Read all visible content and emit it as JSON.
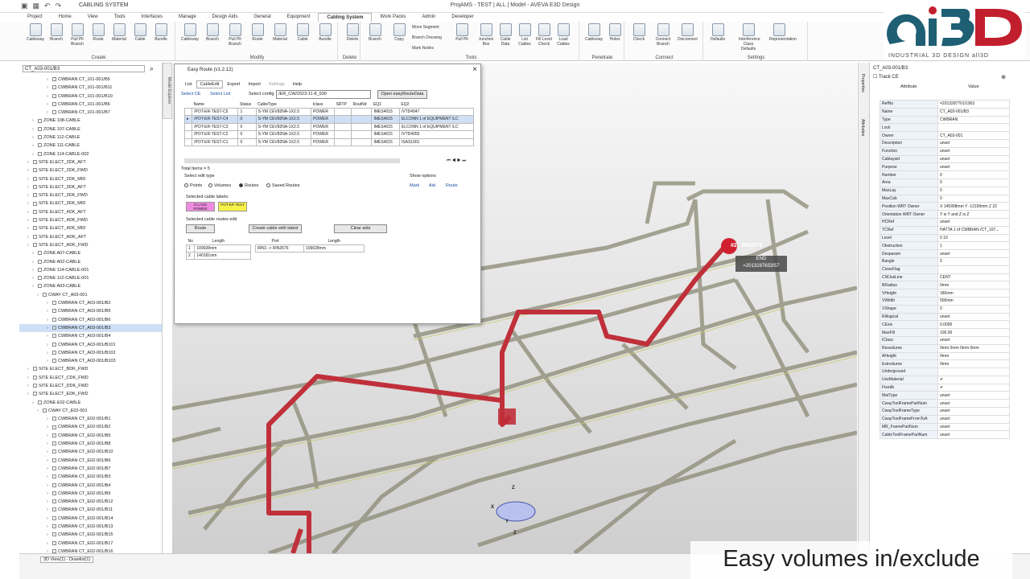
{
  "window": {
    "context_title": "CABLING SYSTEM",
    "title": "ProjAMS - TEST | ALL | Model - AVEVA E3D Design"
  },
  "menu_tabs": [
    "Project",
    "Home",
    "View",
    "Tools",
    "Interfaces",
    "Manage",
    "Design Aids",
    "General",
    "Equipment",
    "Cabling System",
    "Work Packs",
    "Admin",
    "Developer"
  ],
  "active_tab": "Cabling System",
  "ribbon": {
    "groups": [
      "Create",
      "Modify",
      "Delete",
      "Tools",
      "Penetrate",
      "Connect",
      "Settings"
    ],
    "create": [
      "Cableway",
      "Branch",
      "Pull Pit Branch",
      "Route",
      "Material",
      "Cable",
      "Bundle"
    ],
    "modify": [
      "Cableway",
      "Branch",
      "Pull Pit Branch",
      "Route",
      "Material",
      "Cable",
      "Bundle"
    ],
    "delete": [
      "Delete"
    ],
    "tools": [
      "Branch",
      "Copy",
      "Pull Pit",
      "Junction Box",
      "Cable Data",
      "List Cables",
      "Fill Level Check",
      "Load Cables"
    ],
    "tools_small": [
      "Move Segment",
      "Branch Dressing",
      "Mark Nodes"
    ],
    "penetrate": [
      "Cableway",
      "Holes"
    ],
    "connect": [
      "Check",
      "Connect Branch",
      "Disconnect"
    ],
    "settings": [
      "Defaults",
      "Interference Class Defaults",
      "Representation"
    ]
  },
  "brand": {
    "logo_text": "ai3D",
    "tagline": "INDUSTRIAL 3D DESIGN all3D",
    "colors": {
      "a": "#1e5f74",
      "i": "#c21f2e",
      "d": "#c21f2e"
    }
  },
  "explorer": {
    "combo_value": "CT_A03-001/B3",
    "side_tab": "Model Explorer",
    "tree": [
      {
        "d": 5,
        "t": "CWBRAN CT_101-001/B5"
      },
      {
        "d": 5,
        "t": "CWBRAN CT_101-001/B11"
      },
      {
        "d": 5,
        "t": "CWBRAN CT_101-001/B10"
      },
      {
        "d": 5,
        "t": "CWBRAN CT_101-001/B6"
      },
      {
        "d": 5,
        "t": "CWBRAN CT_101-001/B7"
      },
      {
        "d": 2,
        "t": "ZONE 108-CABLE"
      },
      {
        "d": 2,
        "t": "ZONE 107-CABLE"
      },
      {
        "d": 2,
        "t": "ZONE 112-CABLE"
      },
      {
        "d": 2,
        "t": "ZONE 111-CABLE"
      },
      {
        "d": 2,
        "t": "ZONE 114-CABLE-002"
      },
      {
        "d": 1,
        "t": "SITE ELECT_2DK_AFT"
      },
      {
        "d": 1,
        "t": "SITE ELECT_2DK_FWD"
      },
      {
        "d": 1,
        "t": "SITE ELECT_2DK_MID"
      },
      {
        "d": 1,
        "t": "SITE ELECT_3DK_AFT"
      },
      {
        "d": 1,
        "t": "SITE ELECT_3DK_FWD"
      },
      {
        "d": 1,
        "t": "SITE ELECT_3DK_MID"
      },
      {
        "d": 1,
        "t": "SITE ELECT_4DK_AFT"
      },
      {
        "d": 1,
        "t": "SITE ELECT_4DK_FWD"
      },
      {
        "d": 1,
        "t": "SITE ELECT_4DK_MID"
      },
      {
        "d": 1,
        "t": "SITE ELECT_ADK_AFT"
      },
      {
        "d": 1,
        "t": "SITE ELECT_ADK_FWD"
      },
      {
        "d": 2,
        "t": "ZONE A07-CABLE"
      },
      {
        "d": 2,
        "t": "ZONE A02-CABLE"
      },
      {
        "d": 2,
        "t": "ZONE 114-CABLE-001"
      },
      {
        "d": 2,
        "t": "ZONE 112-CABLE-001"
      },
      {
        "d": 2,
        "t": "ZONE A03-CABLE"
      },
      {
        "d": 3,
        "t": "CWAY CT_A03-001"
      },
      {
        "d": 5,
        "t": "CWBRAN CT_A03-001/B2"
      },
      {
        "d": 5,
        "t": "CWBRAN CT_A03-001/B5"
      },
      {
        "d": 5,
        "t": "CWBRAN CT_A03-001/B6"
      },
      {
        "d": 5,
        "t": "CWBRAN CT_A03-001/B3",
        "sel": true
      },
      {
        "d": 5,
        "t": "CWBRAN CT_A03-001/B4"
      },
      {
        "d": 5,
        "t": "CWBRAN CT_A03-001/B101"
      },
      {
        "d": 5,
        "t": "CWBRAN CT_A03-001/B102"
      },
      {
        "d": 5,
        "t": "CWBRAN CT_A03-001/B103"
      },
      {
        "d": 1,
        "t": "SITE ELECT_BDK_FWD"
      },
      {
        "d": 1,
        "t": "SITE ELECT_CDK_FWD"
      },
      {
        "d": 1,
        "t": "SITE ELECT_DDK_FWD"
      },
      {
        "d": 1,
        "t": "SITE ELECT_EDK_FWD"
      },
      {
        "d": 2,
        "t": "ZONE E02-CABLE"
      },
      {
        "d": 3,
        "t": "CWAY CT_E02-001"
      },
      {
        "d": 5,
        "t": "CWBRAN CT_E02-001/B1"
      },
      {
        "d": 5,
        "t": "CWBRAN CT_E02-001/B2"
      },
      {
        "d": 5,
        "t": "CWBRAN CT_E02-001/B5"
      },
      {
        "d": 5,
        "t": "CWBRAN CT_E02-001/B8"
      },
      {
        "d": 5,
        "t": "CWBRAN CT_E02-001/B10"
      },
      {
        "d": 5,
        "t": "CWBRAN CT_E02-001/B6"
      },
      {
        "d": 5,
        "t": "CWBRAN CT_E02-001/B7"
      },
      {
        "d": 5,
        "t": "CWBRAN CT_E02-001/B3"
      },
      {
        "d": 5,
        "t": "CWBRAN CT_E02-001/B4"
      },
      {
        "d": 5,
        "t": "CWBRAN CT_E02-001/B9"
      },
      {
        "d": 5,
        "t": "CWBRAN CT_E02-001/B12"
      },
      {
        "d": 5,
        "t": "CWBRAN CT_E02-001/B11"
      },
      {
        "d": 5,
        "t": "CWBRAN CT_E02-001/B14"
      },
      {
        "d": 5,
        "t": "CWBRAN CT_E02-001/B13"
      },
      {
        "d": 5,
        "t": "CWBRAN CT_E02-001/B15"
      },
      {
        "d": 5,
        "t": "CWBRAN CT_E02-001/B17"
      },
      {
        "d": 5,
        "t": "CWBRAN CT_E02-001/B16"
      }
    ]
  },
  "dialog": {
    "title": "Easy Route (v1.2.12)",
    "tabs": [
      "List",
      "CableEdit",
      "Export",
      "Import",
      "Settings",
      "Help"
    ],
    "active_tab": "CableEdit",
    "links": {
      "select_ce": "Select CE",
      "select_list": "Select List",
      "select_config": "Select config"
    },
    "config_value": "/ER_CW/2023-11-8_930",
    "open_button": "Open easyRouteData",
    "columns": [
      "Name",
      "Status",
      "CableType",
      "Iclass",
      "SRTP",
      "RoutNd",
      "EQ1",
      "EQ2"
    ],
    "rows": [
      [
        "/POT-ER-TEST-C5",
        "1",
        "S-YM CEV82NA-1X2.5",
        "POWER",
        "",
        "",
        "IMES4015",
        "/VTD4047"
      ],
      [
        "/POT-ER-TEST-C4",
        "0",
        "S-YM CEV82NA-1X2.5",
        "POWER",
        "",
        "",
        "IMES4015",
        "ELCONN 1 of EQUIPMENT /LC"
      ],
      [
        "/POT-ER-TEST-C3",
        "0",
        "S-YM CEV82NA-1X2.5",
        "POWER",
        "",
        "",
        "IMES4015",
        "ELCONN 1 of EQUIPMENT /LC"
      ],
      [
        "/POT-ER-TEST-C2",
        "0",
        "S-YM CEV82NA-1X2.5",
        "POWER",
        "",
        "",
        "IMES4015",
        "/VTD4055"
      ],
      [
        "/POT-ER-TEST-C1",
        "0",
        "S-YM CEV82NA-1X2.5",
        "POWER",
        "",
        "",
        "IMES4015",
        "/SAS1001"
      ]
    ],
    "selected_row": 1,
    "total_items": "Total Items = 5",
    "select_edit_type": "Select edit type",
    "edit_types": [
      "Points",
      "Volumes",
      "Routes",
      "Saved Routes"
    ],
    "edit_type_selected": "Routes",
    "show_options": "Show options",
    "show_links": [
      "Mark",
      "Aid",
      "Route"
    ],
    "selected_cable_labels": "Selected cable labels:",
    "label_swatches": [
      {
        "t": "ICLASS POWER",
        "c": "#f08ce0"
      },
      {
        "t": "POT-ER TEST",
        "c": "#f6f24a"
      }
    ],
    "selected_routes_edit": "Selected cable routes edit",
    "btn_route": "Route",
    "btn_create": "Create cable with latest",
    "btn_clear": "Clear aids",
    "route_cols": [
      "No",
      "Length"
    ],
    "route_rows": [
      [
        "1",
        "109028mm"
      ],
      [
        "2",
        "140181mm"
      ]
    ],
    "port_cols": [
      "Port",
      "Length"
    ],
    "port_rows": [
      [
        "IRN1 -> /RN2676",
        "109028mm"
      ]
    ]
  },
  "viewport": {
    "marker_label": "#2 - RN2676",
    "end_label": "END",
    "end_value": "=2013287653/57",
    "gizmo_axes": [
      "Z",
      "X",
      "Y",
      "Z"
    ]
  },
  "attributes": {
    "title": "CT_A03-001/B3",
    "track_ce": "Track CE",
    "col_attr": "Attribute",
    "col_value": "Value",
    "side_tabs": [
      "Properties",
      "Attributes"
    ],
    "rows": [
      [
        "RefNo",
        "=2013287701/1902"
      ],
      [
        "Name",
        "CT_A03-001/B3"
      ],
      [
        "Type",
        "CWBRAN"
      ],
      [
        "Lock",
        ""
      ],
      [
        "Owner",
        "CT_A03-001"
      ],
      [
        "Description",
        "unset"
      ],
      [
        "Function",
        "unset"
      ],
      [
        "Cablaysid",
        "unset"
      ],
      [
        "Purpose",
        "unset"
      ],
      [
        "Number",
        "0"
      ],
      [
        "Area",
        "0"
      ],
      [
        "MaxLay",
        "0"
      ],
      [
        "MaxCab",
        "0"
      ],
      [
        "Position WRT Owner",
        "X 145908mm Y -12190mm Z 22"
      ],
      [
        "Orientation WRT Owner",
        "Y is Y and Z is Z"
      ],
      [
        "HCRef",
        "unset"
      ],
      [
        "TCRef",
        "HATTA 1 of CWBRAN /CT_107..."
      ],
      [
        "Level",
        "0 10"
      ],
      [
        "Obstruction",
        "1"
      ],
      [
        "Desparam",
        "unset"
      ],
      [
        "Bangle",
        "0"
      ],
      [
        "CloseFlag",
        ""
      ],
      [
        "CWJusLine",
        "CENT"
      ],
      [
        "BRadius",
        "0mm"
      ],
      [
        "VHeight",
        "180mm"
      ],
      [
        "VWidth",
        "500mm"
      ],
      [
        "VShape",
        "0"
      ],
      [
        "Rillogical",
        "unset"
      ],
      [
        "CExis",
        "0.0000"
      ],
      [
        "MaxFill",
        "100.00"
      ],
      [
        "IClass",
        "unset"
      ],
      [
        "Resvolume",
        "0mm 0mm 0mm 0mm"
      ],
      [
        "AHeight",
        "0mm"
      ],
      [
        "Extrvolume",
        "0mm"
      ],
      [
        "Underground",
        ""
      ],
      [
        "UseMaterial",
        "✔"
      ],
      [
        "Fixedb",
        "✔"
      ],
      [
        "MatType",
        "unset"
      ],
      [
        "CwayToolFramePartNum",
        "unset"
      ],
      [
        "CwayToolFrameType",
        "unset"
      ],
      [
        "CwayToolFrameFromToA",
        "unset"
      ],
      [
        "MR_FramePartNum",
        "unset"
      ],
      [
        "CableToolFramePartNum",
        "unset"
      ]
    ]
  },
  "statusbar": {
    "doc_tab": "3D View(1) - Drawlist(1)"
  },
  "caption": "Easy volumes in/exclude"
}
